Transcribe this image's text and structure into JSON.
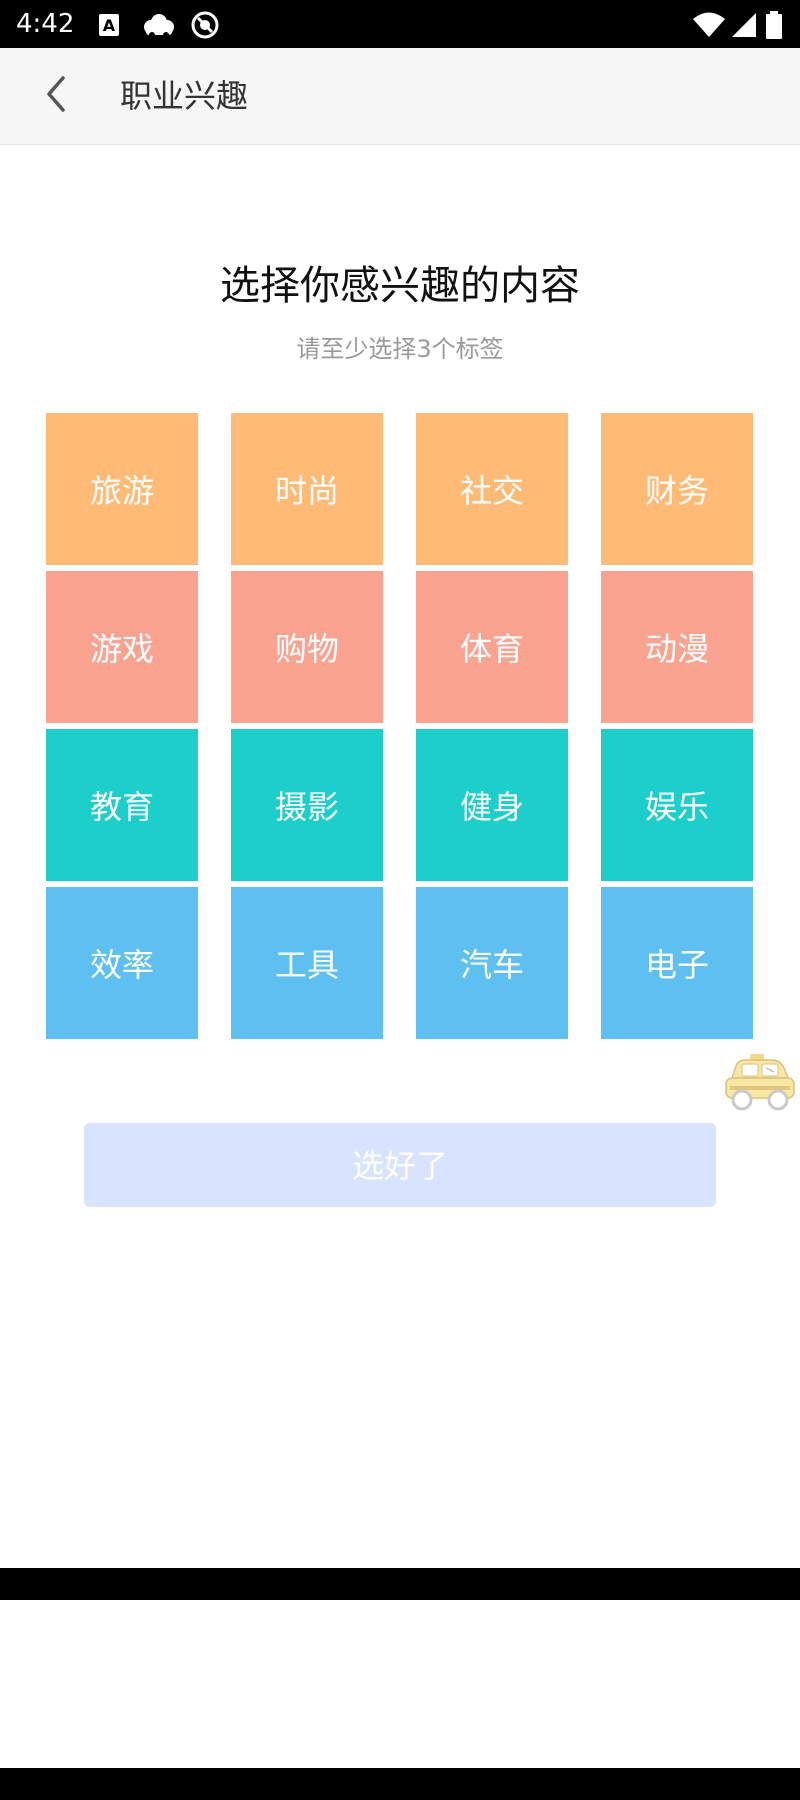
{
  "status_bar": {
    "time": "4:42",
    "left_icons": [
      "text-a-icon",
      "cloud-icon",
      "vpn-icon"
    ],
    "right_icons": [
      "wifi-icon",
      "cell-signal-icon",
      "battery-icon"
    ]
  },
  "app_bar": {
    "back_icon": "chevron-left-icon",
    "title": "职业兴趣"
  },
  "content": {
    "heading": "选择你感兴趣的内容",
    "subheading": "请至少选择3个标签"
  },
  "tag_rows": [
    {
      "color": "#ffba75",
      "tags": [
        "旅游",
        "时尚",
        "社交",
        "财务"
      ]
    },
    {
      "color": "#fba391",
      "tags": [
        "游戏",
        "购物",
        "体育",
        "动漫"
      ]
    },
    {
      "color": "#1dcfcb",
      "tags": [
        "教育",
        "摄影",
        "健身",
        "娱乐"
      ]
    },
    {
      "color": "#5dc0f0",
      "tags": [
        "效率",
        "工具",
        "汽车",
        "电子"
      ]
    }
  ],
  "floating_icon": "taxi-icon",
  "confirm_button": {
    "label": "选好了",
    "background": "#d8e4fd"
  }
}
